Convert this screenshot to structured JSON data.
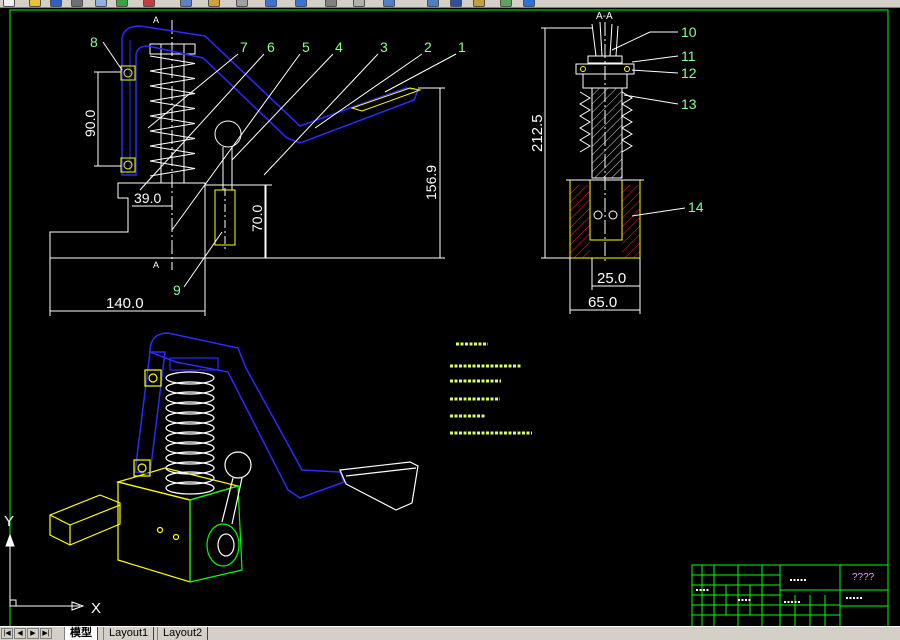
{
  "toolbar": {
    "icons": [
      "new-icon",
      "open-icon",
      "save-icon",
      "print-icon",
      "preview-icon",
      "publish-icon",
      "cut-icon",
      "copy-icon",
      "paste-icon",
      "match-properties-icon",
      "undo-icon",
      "redo-icon",
      "pan-icon",
      "zoom-realtime-icon",
      "zoom-window-icon",
      "zoom-previous-icon",
      "properties-icon",
      "design-center-icon",
      "tool-palette-icon",
      "help-icon"
    ]
  },
  "colors": {
    "background": "#000000",
    "line": "#ffffff",
    "lever": "#2a2aff",
    "part": "#ffff00",
    "frame": "#00ff00",
    "hatch": "#ff2020",
    "label": "#8cff8c"
  },
  "front_view": {
    "section_mark_top": "A",
    "section_mark_bottom": "A",
    "labels": {
      "l1": "1",
      "l2": "2",
      "l3": "3",
      "l4": "4",
      "l5": "5",
      "l6": "6",
      "l7": "7",
      "l8": "8",
      "l9": "9"
    },
    "dims": {
      "height_90": "90.0",
      "height_156": "156.9",
      "width_39": "39.0",
      "height_70": "70.0",
      "width_140": "140.0"
    }
  },
  "section_view": {
    "title": "A-A",
    "labels": {
      "l10": "10",
      "l11": "11",
      "l12": "12",
      "l13": "13",
      "l14": "14"
    },
    "dims": {
      "height_212": "212.5",
      "width_25": "25.0",
      "width_65": "65.0"
    }
  },
  "title_block": {
    "drawing_name": "????"
  },
  "ucs": {
    "x_label": "X",
    "y_label": "Y"
  },
  "tabs": {
    "model": "模型",
    "layout1": "Layout1",
    "layout2": "Layout2"
  }
}
